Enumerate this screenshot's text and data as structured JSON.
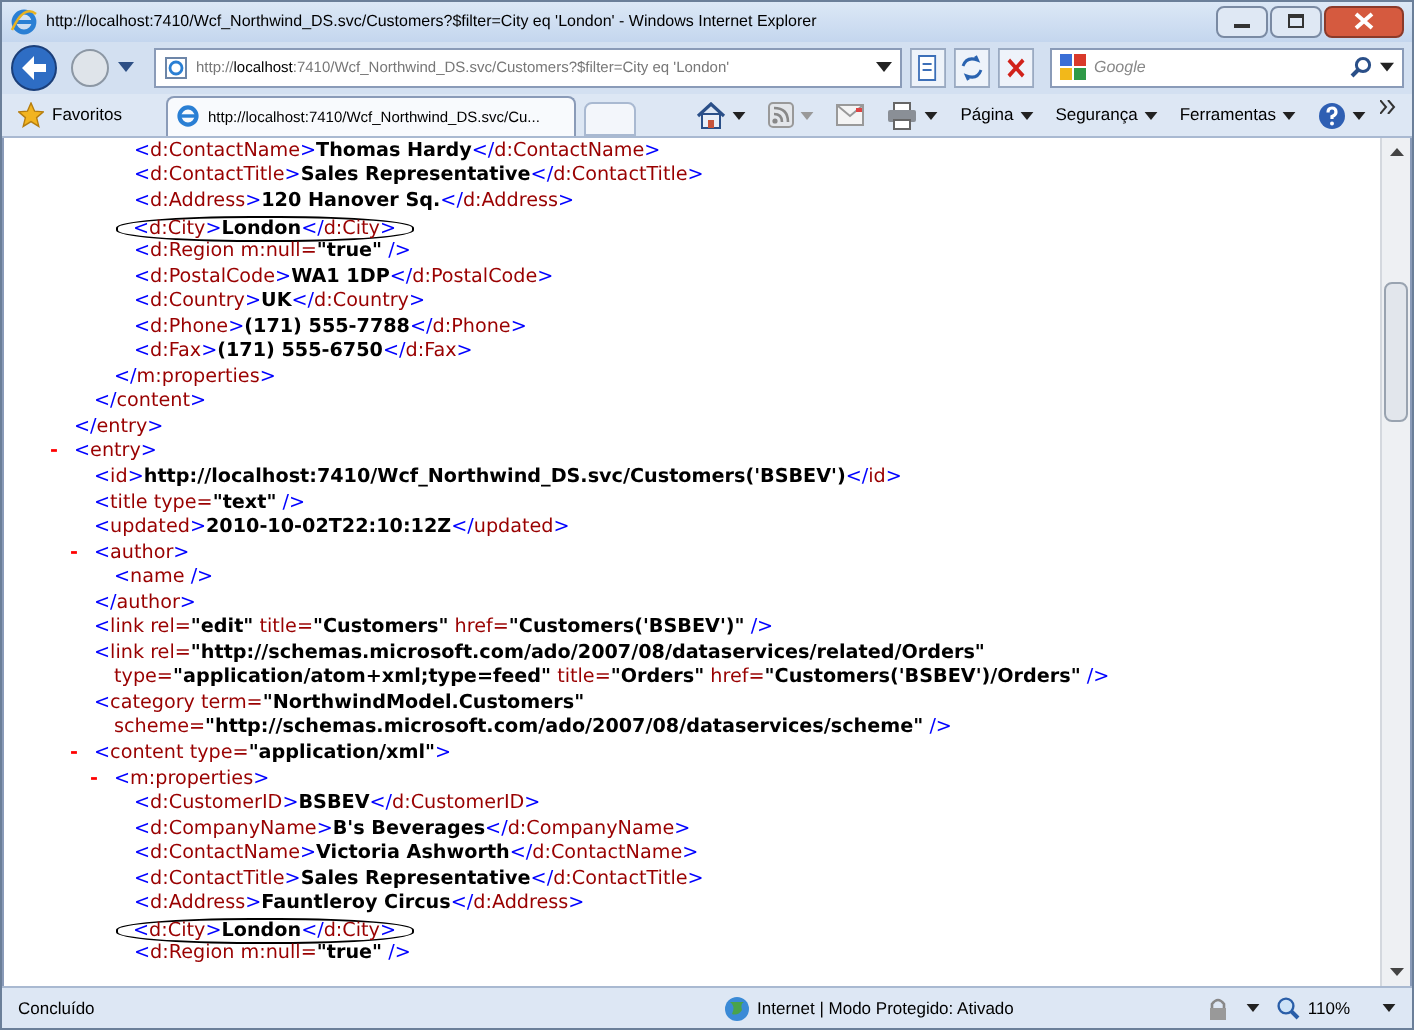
{
  "window": {
    "title": "http://localhost:7410/Wcf_Northwind_DS.svc/Customers?$filter=City eq 'London' - Windows Internet Explorer"
  },
  "address_bar": {
    "value": "http://**localhost**:7410/Wcf_Northwind_DS.svc/Customers?$filter=City eq 'London'"
  },
  "search": {
    "placeholder": "Google"
  },
  "favorites": {
    "label": "Favoritos"
  },
  "tabs": [
    {
      "label": "http://localhost:7410/Wcf_Northwind_DS.svc/Cu...",
      "selected": true
    }
  ],
  "command_bar": [
    "Página",
    "Segurança",
    "Ferramentas"
  ],
  "xml": [
    {
      "children": [
        {
          "children": [
            {
              "children": [
                {
                  "tokens": [
                    {
                      "kind": "p",
                      "text": "<"
                    },
                    {
                      "kind": "n",
                      "text": "d:ContactName"
                    },
                    {
                      "kind": "p",
                      "text": ">"
                    },
                    {
                      "kind": "v",
                      "text": "Thomas Hardy"
                    },
                    {
                      "kind": "p",
                      "text": "</"
                    },
                    {
                      "kind": "n",
                      "text": "d:ContactName"
                    },
                    {
                      "kind": "p",
                      "text": ">"
                    }
                  ]
                },
                {
                  "tokens": [
                    {
                      "kind": "p",
                      "text": "<"
                    },
                    {
                      "kind": "n",
                      "text": "d:ContactTitle"
                    },
                    {
                      "kind": "p",
                      "text": ">"
                    },
                    {
                      "kind": "v",
                      "text": "Sales Representative"
                    },
                    {
                      "kind": "p",
                      "text": "</"
                    },
                    {
                      "kind": "n",
                      "text": "d:ContactTitle"
                    },
                    {
                      "kind": "p",
                      "text": ">"
                    }
                  ]
                },
                {
                  "tokens": [
                    {
                      "kind": "p",
                      "text": "<"
                    },
                    {
                      "kind": "n",
                      "text": "d:Address"
                    },
                    {
                      "kind": "p",
                      "text": ">"
                    },
                    {
                      "kind": "v",
                      "text": "120 Hanover Sq."
                    },
                    {
                      "kind": "p",
                      "text": "</"
                    },
                    {
                      "kind": "n",
                      "text": "d:Address"
                    },
                    {
                      "kind": "p",
                      "text": ">"
                    }
                  ]
                },
                {
                  "circled": true,
                  "tokens": [
                    {
                      "kind": "p",
                      "text": "<"
                    },
                    {
                      "kind": "n",
                      "text": "d:City"
                    },
                    {
                      "kind": "p",
                      "text": ">"
                    },
                    {
                      "kind": "v",
                      "text": "London"
                    },
                    {
                      "kind": "p",
                      "text": "</"
                    },
                    {
                      "kind": "n",
                      "text": "d:City"
                    },
                    {
                      "kind": "p",
                      "text": ">"
                    }
                  ]
                },
                {
                  "tokens": [
                    {
                      "kind": "p",
                      "text": "<"
                    },
                    {
                      "kind": "n",
                      "text": "d:Region"
                    },
                    {
                      "kind": "a",
                      "text": " m:null="
                    },
                    {
                      "kind": "v",
                      "text": "\"true\""
                    },
                    {
                      "kind": "p",
                      "text": " />"
                    }
                  ]
                },
                {
                  "tokens": [
                    {
                      "kind": "p",
                      "text": "<"
                    },
                    {
                      "kind": "n",
                      "text": "d:PostalCode"
                    },
                    {
                      "kind": "p",
                      "text": ">"
                    },
                    {
                      "kind": "v",
                      "text": "WA1 1DP"
                    },
                    {
                      "kind": "p",
                      "text": "</"
                    },
                    {
                      "kind": "n",
                      "text": "d:PostalCode"
                    },
                    {
                      "kind": "p",
                      "text": ">"
                    }
                  ]
                },
                {
                  "tokens": [
                    {
                      "kind": "p",
                      "text": "<"
                    },
                    {
                      "kind": "n",
                      "text": "d:Country"
                    },
                    {
                      "kind": "p",
                      "text": ">"
                    },
                    {
                      "kind": "v",
                      "text": "UK"
                    },
                    {
                      "kind": "p",
                      "text": "</"
                    },
                    {
                      "kind": "n",
                      "text": "d:Country"
                    },
                    {
                      "kind": "p",
                      "text": ">"
                    }
                  ]
                },
                {
                  "tokens": [
                    {
                      "kind": "p",
                      "text": "<"
                    },
                    {
                      "kind": "n",
                      "text": "d:Phone"
                    },
                    {
                      "kind": "p",
                      "text": ">"
                    },
                    {
                      "kind": "v",
                      "text": "(171) 555-7788"
                    },
                    {
                      "kind": "p",
                      "text": "</"
                    },
                    {
                      "kind": "n",
                      "text": "d:Phone"
                    },
                    {
                      "kind": "p",
                      "text": ">"
                    }
                  ]
                },
                {
                  "tokens": [
                    {
                      "kind": "p",
                      "text": "<"
                    },
                    {
                      "kind": "n",
                      "text": "d:Fax"
                    },
                    {
                      "kind": "p",
                      "text": ">"
                    },
                    {
                      "kind": "v",
                      "text": "(171) 555-6750"
                    },
                    {
                      "kind": "p",
                      "text": "</"
                    },
                    {
                      "kind": "n",
                      "text": "d:Fax"
                    },
                    {
                      "kind": "p",
                      "text": ">"
                    }
                  ]
                }
              ]
            },
            {
              "tokens": [
                {
                  "kind": "p",
                  "text": "</"
                },
                {
                  "kind": "n",
                  "text": "m:properties"
                },
                {
                  "kind": "p",
                  "text": ">"
                }
              ]
            }
          ]
        },
        {
          "tokens": [
            {
              "kind": "p",
              "text": "</"
            },
            {
              "kind": "n",
              "text": "content"
            },
            {
              "kind": "p",
              "text": ">"
            }
          ]
        }
      ]
    },
    {
      "tokens": [
        {
          "kind": "p",
          "text": "</"
        },
        {
          "kind": "n",
          "text": "entry"
        },
        {
          "kind": "p",
          "text": ">"
        }
      ]
    },
    {
      "toggle": "-",
      "tokens": [
        {
          "kind": "p",
          "text": "<"
        },
        {
          "kind": "n",
          "text": "entry"
        },
        {
          "kind": "p",
          "text": ">"
        }
      ],
      "children": [
        {
          "tokens": [
            {
              "kind": "p",
              "text": "<"
            },
            {
              "kind": "n",
              "text": "id"
            },
            {
              "kind": "p",
              "text": ">"
            },
            {
              "kind": "v",
              "text": "http://localhost:7410/Wcf_Northwind_DS.svc/Customers('BSBEV')"
            },
            {
              "kind": "p",
              "text": "</"
            },
            {
              "kind": "n",
              "text": "id"
            },
            {
              "kind": "p",
              "text": ">"
            }
          ]
        },
        {
          "tokens": [
            {
              "kind": "p",
              "text": "<"
            },
            {
              "kind": "n",
              "text": "title"
            },
            {
              "kind": "a",
              "text": " type="
            },
            {
              "kind": "v",
              "text": "\"text\""
            },
            {
              "kind": "p",
              "text": " />"
            }
          ]
        },
        {
          "tokens": [
            {
              "kind": "p",
              "text": "<"
            },
            {
              "kind": "n",
              "text": "updated"
            },
            {
              "kind": "p",
              "text": ">"
            },
            {
              "kind": "v",
              "text": "2010-10-02T22:10:12Z"
            },
            {
              "kind": "p",
              "text": "</"
            },
            {
              "kind": "n",
              "text": "updated"
            },
            {
              "kind": "p",
              "text": ">"
            }
          ]
        },
        {
          "toggle": "-",
          "tokens": [
            {
              "kind": "p",
              "text": "<"
            },
            {
              "kind": "n",
              "text": "author"
            },
            {
              "kind": "p",
              "text": ">"
            }
          ],
          "children": [
            {
              "tokens": [
                {
                  "kind": "p",
                  "text": "<"
                },
                {
                  "kind": "n",
                  "text": "name"
                },
                {
                  "kind": "p",
                  "text": " />"
                }
              ]
            }
          ]
        },
        {
          "tokens": [
            {
              "kind": "p",
              "text": "</"
            },
            {
              "kind": "n",
              "text": "author"
            },
            {
              "kind": "p",
              "text": ">"
            }
          ]
        },
        {
          "tokens": [
            {
              "kind": "p",
              "text": "<"
            },
            {
              "kind": "n",
              "text": "link"
            },
            {
              "kind": "a",
              "text": " rel="
            },
            {
              "kind": "v",
              "text": "\"edit\""
            },
            {
              "kind": "a",
              "text": " title="
            },
            {
              "kind": "v",
              "text": "\"Customers\""
            },
            {
              "kind": "a",
              "text": " href="
            },
            {
              "kind": "v",
              "text": "\"Customers('BSBEV')\""
            },
            {
              "kind": "p",
              "text": " />"
            }
          ]
        },
        {
          "tokens": [
            {
              "kind": "p",
              "text": "<"
            },
            {
              "kind": "n",
              "text": "link"
            },
            {
              "kind": "a",
              "text": " rel="
            },
            {
              "kind": "v",
              "text": "\"http://schemas.microsoft.com/ado/2007/08/dataservices/related/Orders\""
            }
          ],
          "wrap": [
            {
              "kind": "a",
              "text": "type="
            },
            {
              "kind": "v",
              "text": "\"application/atom+xml;type=feed\""
            },
            {
              "kind": "a",
              "text": " title="
            },
            {
              "kind": "v",
              "text": "\"Orders\""
            },
            {
              "kind": "a",
              "text": " href="
            },
            {
              "kind": "v",
              "text": "\"Customers('BSBEV')/Orders\""
            },
            {
              "kind": "p",
              "text": " />"
            }
          ]
        },
        {
          "tokens": [
            {
              "kind": "p",
              "text": "<"
            },
            {
              "kind": "n",
              "text": "category"
            },
            {
              "kind": "a",
              "text": " term="
            },
            {
              "kind": "v",
              "text": "\"NorthwindModel.Customers\""
            }
          ],
          "wrap": [
            {
              "kind": "a",
              "text": "scheme="
            },
            {
              "kind": "v",
              "text": "\"http://schemas.microsoft.com/ado/2007/08/dataservices/scheme\""
            },
            {
              "kind": "p",
              "text": " />"
            }
          ]
        },
        {
          "toggle": "-",
          "tokens": [
            {
              "kind": "p",
              "text": "<"
            },
            {
              "kind": "n",
              "text": "content"
            },
            {
              "kind": "a",
              "text": " type="
            },
            {
              "kind": "v",
              "text": "\"application/xml\""
            },
            {
              "kind": "p",
              "text": ">"
            }
          ],
          "children": [
            {
              "toggle": "-",
              "tokens": [
                {
                  "kind": "p",
                  "text": "<"
                },
                {
                  "kind": "n",
                  "text": "m:properties"
                },
                {
                  "kind": "p",
                  "text": ">"
                }
              ],
              "children": [
                {
                  "tokens": [
                    {
                      "kind": "p",
                      "text": "<"
                    },
                    {
                      "kind": "n",
                      "text": "d:CustomerID"
                    },
                    {
                      "kind": "p",
                      "text": ">"
                    },
                    {
                      "kind": "v",
                      "text": "BSBEV"
                    },
                    {
                      "kind": "p",
                      "text": "</"
                    },
                    {
                      "kind": "n",
                      "text": "d:CustomerID"
                    },
                    {
                      "kind": "p",
                      "text": ">"
                    }
                  ]
                },
                {
                  "tokens": [
                    {
                      "kind": "p",
                      "text": "<"
                    },
                    {
                      "kind": "n",
                      "text": "d:CompanyName"
                    },
                    {
                      "kind": "p",
                      "text": ">"
                    },
                    {
                      "kind": "v",
                      "text": "B's Beverages"
                    },
                    {
                      "kind": "p",
                      "text": "</"
                    },
                    {
                      "kind": "n",
                      "text": "d:CompanyName"
                    },
                    {
                      "kind": "p",
                      "text": ">"
                    }
                  ]
                },
                {
                  "tokens": [
                    {
                      "kind": "p",
                      "text": "<"
                    },
                    {
                      "kind": "n",
                      "text": "d:ContactName"
                    },
                    {
                      "kind": "p",
                      "text": ">"
                    },
                    {
                      "kind": "v",
                      "text": "Victoria Ashworth"
                    },
                    {
                      "kind": "p",
                      "text": "</"
                    },
                    {
                      "kind": "n",
                      "text": "d:ContactName"
                    },
                    {
                      "kind": "p",
                      "text": ">"
                    }
                  ]
                },
                {
                  "tokens": [
                    {
                      "kind": "p",
                      "text": "<"
                    },
                    {
                      "kind": "n",
                      "text": "d:ContactTitle"
                    },
                    {
                      "kind": "p",
                      "text": ">"
                    },
                    {
                      "kind": "v",
                      "text": "Sales Representative"
                    },
                    {
                      "kind": "p",
                      "text": "</"
                    },
                    {
                      "kind": "n",
                      "text": "d:ContactTitle"
                    },
                    {
                      "kind": "p",
                      "text": ">"
                    }
                  ]
                },
                {
                  "tokens": [
                    {
                      "kind": "p",
                      "text": "<"
                    },
                    {
                      "kind": "n",
                      "text": "d:Address"
                    },
                    {
                      "kind": "p",
                      "text": ">"
                    },
                    {
                      "kind": "v",
                      "text": "Fauntleroy Circus"
                    },
                    {
                      "kind": "p",
                      "text": "</"
                    },
                    {
                      "kind": "n",
                      "text": "d:Address"
                    },
                    {
                      "kind": "p",
                      "text": ">"
                    }
                  ]
                },
                {
                  "circled": true,
                  "tokens": [
                    {
                      "kind": "p",
                      "text": "<"
                    },
                    {
                      "kind": "n",
                      "text": "d:City"
                    },
                    {
                      "kind": "p",
                      "text": ">"
                    },
                    {
                      "kind": "v",
                      "text": "London"
                    },
                    {
                      "kind": "p",
                      "text": "</"
                    },
                    {
                      "kind": "n",
                      "text": "d:City"
                    },
                    {
                      "kind": "p",
                      "text": ">"
                    }
                  ]
                },
                {
                  "tokens": [
                    {
                      "kind": "p",
                      "text": "<"
                    },
                    {
                      "kind": "n",
                      "text": "d:Region"
                    },
                    {
                      "kind": "a",
                      "text": " m:null="
                    },
                    {
                      "kind": "v",
                      "text": "\"true\""
                    },
                    {
                      "kind": "p",
                      "text": " />"
                    }
                  ]
                }
              ]
            }
          ]
        }
      ]
    }
  ],
  "status_bar": {
    "text": "Concluído",
    "zone": "Internet | Modo Protegido: Ativado",
    "zoom": "110%"
  }
}
